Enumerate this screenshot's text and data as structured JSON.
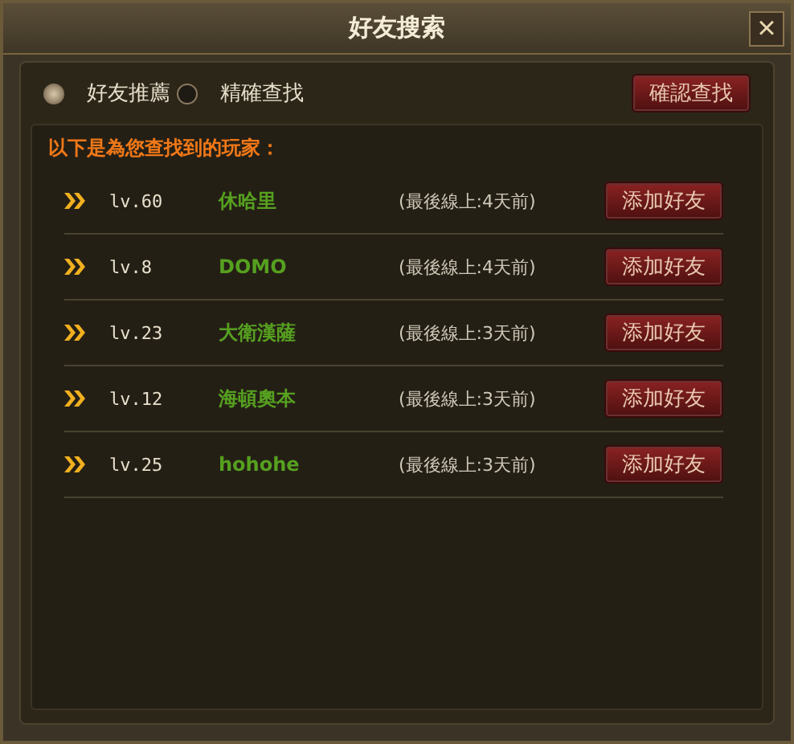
{
  "window": {
    "title": "好友搜索",
    "close": "×"
  },
  "modes": [
    {
      "label": "好友推薦",
      "selected": true
    },
    {
      "label": "精確查找",
      "selected": false
    }
  ],
  "confirm_button": "確認查找",
  "results_heading": "以下是為您查找到的玩家：",
  "players": [
    {
      "level": "lv.60",
      "name": "休哈里",
      "last_online": "(最後線上:4天前)",
      "action": "添加好友"
    },
    {
      "level": "lv.8",
      "name": "DOMO",
      "last_online": "(最後線上:4天前)",
      "action": "添加好友"
    },
    {
      "level": "lv.23",
      "name": "大衛漢薩",
      "last_online": "(最後線上:3天前)",
      "action": "添加好友"
    },
    {
      "level": "lv.12",
      "name": "海頓奧本",
      "last_online": "(最後線上:3天前)",
      "action": "添加好友"
    },
    {
      "level": "lv.25",
      "name": "hohohe",
      "last_online": "(最後線上:3天前)",
      "action": "添加好友"
    }
  ]
}
